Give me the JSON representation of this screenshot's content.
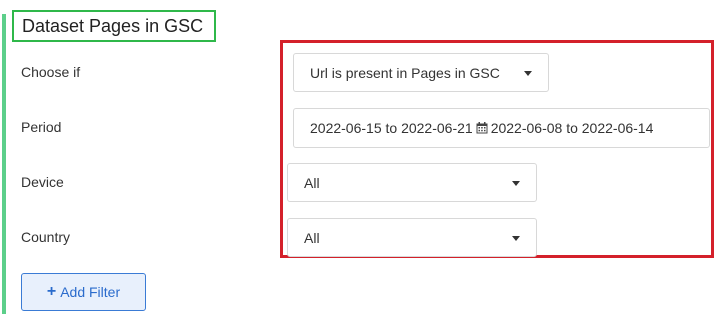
{
  "section": {
    "title": "Dataset Pages in GSC"
  },
  "rows": {
    "choose_if": {
      "label": "Choose if",
      "value": "Url is present in Pages in GSC"
    },
    "period": {
      "label": "Period",
      "range_a": "2022-06-15 to 2022-06-21",
      "range_b": "2022-06-08 to 2022-06-14"
    },
    "device": {
      "label": "Device",
      "value": "All"
    },
    "country": {
      "label": "Country",
      "value": "All"
    }
  },
  "actions": {
    "add_filter_label": "Add Filter",
    "add_filter_icon": "plus-icon"
  },
  "colors": {
    "accent_green": "#5ccf8a",
    "title_border": "#2fb84a",
    "highlight_red": "#d4202a",
    "button_blue": "#2a6bcc"
  }
}
